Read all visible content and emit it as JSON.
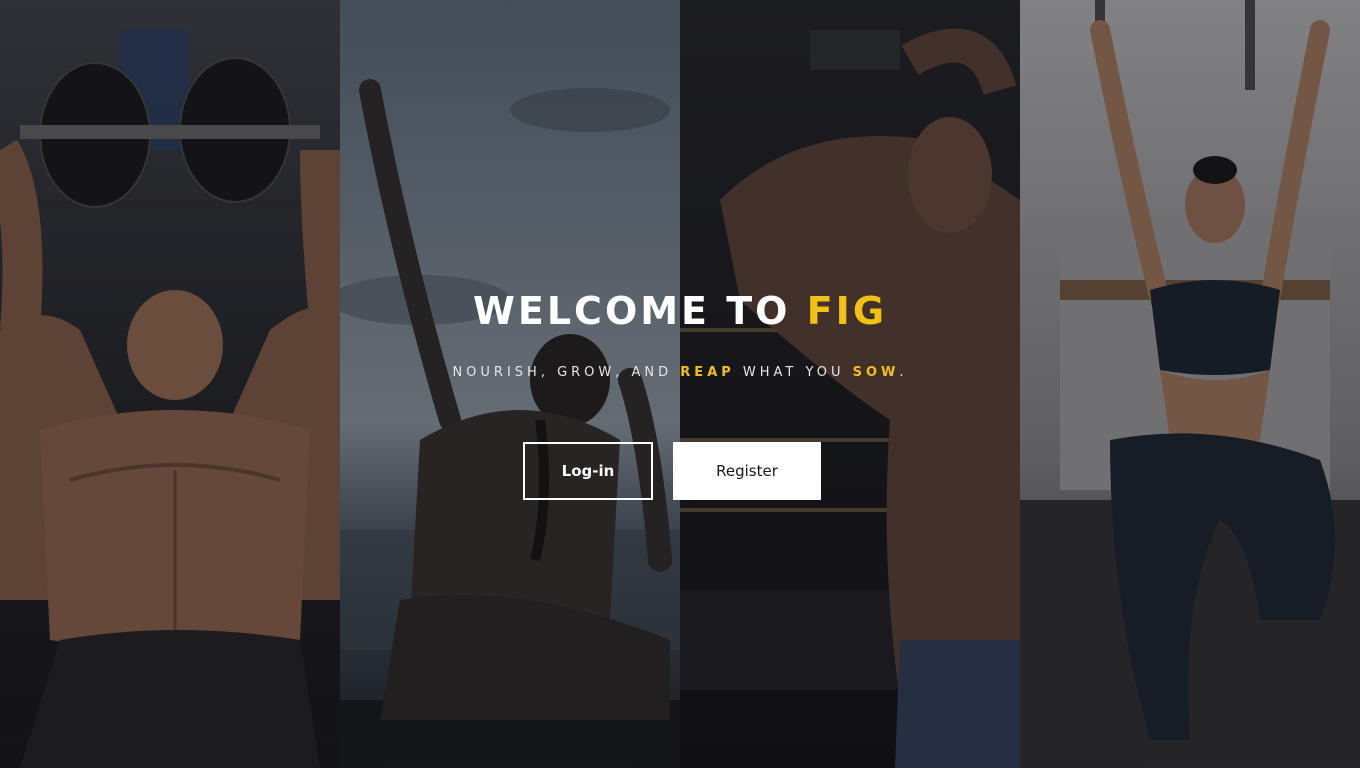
{
  "hero": {
    "title_prefix": "WELCOME TO",
    "title_accent": "FIG",
    "tagline_part1": "NOURISH, GROW, AND",
    "tagline_accent1": "REAP",
    "tagline_part2": "WHAT YOU",
    "tagline_accent2": "SOW",
    "tagline_end": "."
  },
  "actions": {
    "login_label": "Log-in",
    "register_label": "Register"
  },
  "panels": [
    {
      "subject": "bench-press-photo"
    },
    {
      "subject": "yoga-beach-photo"
    },
    {
      "subject": "boxing-gym-photo"
    },
    {
      "subject": "hanging-workout-photo"
    }
  ],
  "colors": {
    "accent": "#f3c114",
    "text": "#ffffff",
    "button_fill": "#ffffff"
  }
}
